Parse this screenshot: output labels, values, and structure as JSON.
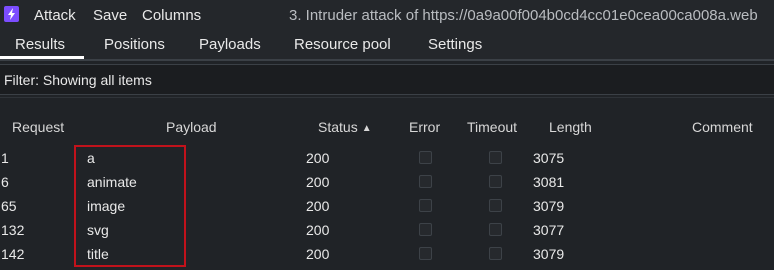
{
  "menubar": {
    "items": [
      "Attack",
      "Save",
      "Columns"
    ],
    "window_title": "3. Intruder attack of https://0a9a00f004b0cd4cc01e0cea00ca008a.web"
  },
  "tabs": [
    "Results",
    "Positions",
    "Payloads",
    "Resource pool",
    "Settings"
  ],
  "active_tab": "Results",
  "filter": {
    "text": "Filter: Showing all items"
  },
  "table": {
    "columns": [
      "Request",
      "Payload",
      "Status",
      "Error",
      "Timeout",
      "Length",
      "Comment"
    ],
    "sorted_column": "Status",
    "sort_direction": "ascending",
    "rows": [
      {
        "request": "1",
        "payload": "a",
        "status": "200",
        "error": false,
        "timeout": false,
        "length": "3075",
        "comment": ""
      },
      {
        "request": "6",
        "payload": "animate",
        "status": "200",
        "error": false,
        "timeout": false,
        "length": "3081",
        "comment": ""
      },
      {
        "request": "65",
        "payload": "image",
        "status": "200",
        "error": false,
        "timeout": false,
        "length": "3079",
        "comment": ""
      },
      {
        "request": "132",
        "payload": "svg",
        "status": "200",
        "error": false,
        "timeout": false,
        "length": "3077",
        "comment": ""
      },
      {
        "request": "142",
        "payload": "title",
        "status": "200",
        "error": false,
        "timeout": false,
        "length": "3079",
        "comment": ""
      }
    ]
  },
  "colors": {
    "highlight": "#c1121b",
    "background": "#202327",
    "logo": "#7c4dff"
  }
}
